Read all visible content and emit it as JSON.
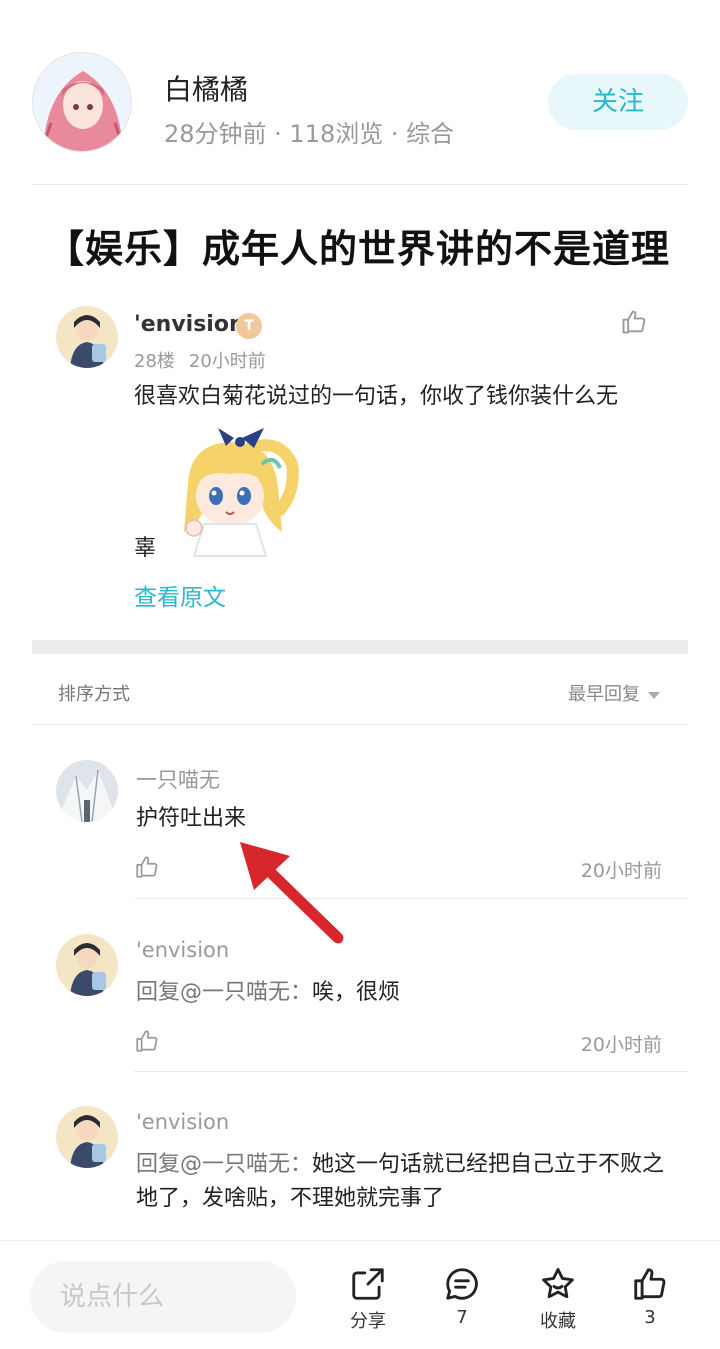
{
  "author": {
    "name": "白橘橘",
    "meta": "28分钟前 · 118浏览 · 综合",
    "follow_label": "关注"
  },
  "post": {
    "title": "【娱乐】成年人的世界讲的不是道理"
  },
  "original_comment": {
    "username": "'envision",
    "level_badge": "T",
    "floor": "28楼",
    "time": "20小时前",
    "text_line1": "很喜欢白菊花说过的一句话，你收了钱你装什么无",
    "text_line2": "辜",
    "view_original_label": "查看原文"
  },
  "sort": {
    "label": "排序方式",
    "selected": "最早回复"
  },
  "replies": [
    {
      "username": "一只喵无",
      "text": "护符吐出来",
      "time": "20小时前"
    },
    {
      "username": "'envision",
      "mention": "回复@一只喵无：",
      "text": "唉，很烦",
      "time": "20小时前"
    },
    {
      "username": "'envision",
      "mention": "回复@一只喵无：",
      "text": "她这一句话就已经把自己立于不败之地了，发啥贴，不理她就完事了"
    }
  ],
  "bottom_bar": {
    "input_placeholder": "说点什么",
    "share_label": "分享",
    "comment_count": "7",
    "favorite_label": "收藏",
    "like_count": "3"
  },
  "colors": {
    "accent": "#27b9cc",
    "annotation_arrow": "#d8262d"
  }
}
